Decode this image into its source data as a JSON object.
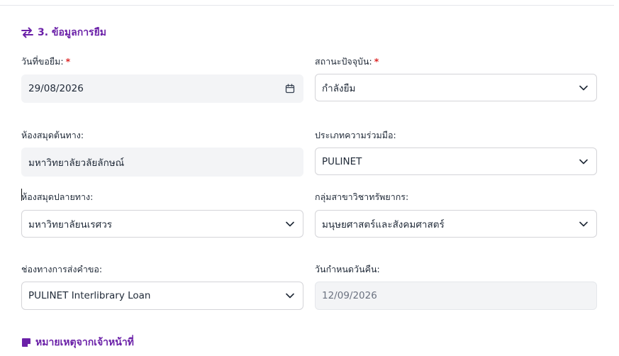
{
  "section3": {
    "title": "3. ข้อมูลการยืม"
  },
  "fields": {
    "borrow_date": {
      "label": "วันที่ขอยืม:",
      "required": "*",
      "value": "29/08/2026"
    },
    "status": {
      "label": "สถานะปัจจุบัน:",
      "required": "*",
      "value": "กำลังยืม"
    },
    "source_library": {
      "label": "ห้องสมุดต้นทาง:",
      "value": "มหาวิทยาลัยวลัยลักษณ์"
    },
    "cooperation_type": {
      "label": "ประเภทความร่วมมือ:",
      "value": "PULINET"
    },
    "destination_library": {
      "label": "ห้องสมุดปลายทาง:",
      "value": "มหาวิทยาลัยนเรศวร"
    },
    "subject_group": {
      "label": "กลุ่มสาขาวิชาทรัพยากร:",
      "value": "มนุษยศาสตร์และสังคมศาสตร์"
    },
    "request_channel": {
      "label": "ช่องทางการส่งคำขอ:",
      "value": "PULINET Interlibrary Loan"
    },
    "due_date": {
      "label": "วันกำหนดวันคืน:",
      "value": "12/09/2026"
    }
  },
  "section4": {
    "title": "หมายเหตุจากเจ้าหน้าที่"
  },
  "icons": {
    "section3": "swap-arrows-icon",
    "section4": "note-icon",
    "date": "calendar-icon",
    "dropdown": "chevron-down-icon"
  },
  "colors": {
    "accent": "#6b21a8",
    "required": "#dc2626",
    "readonly_bg": "#f3f4f6",
    "border": "#d4d4d8"
  }
}
